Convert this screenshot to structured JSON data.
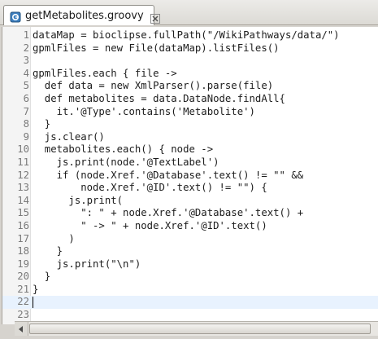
{
  "tab": {
    "title": "getMetabolites.groovy",
    "icon": "groovy-file-icon",
    "close_icon": "close-icon"
  },
  "editor": {
    "current_line": 22,
    "lines": [
      {
        "n": "1",
        "text": "dataMap = bioclipse.fullPath(\"/WikiPathways/data/\")"
      },
      {
        "n": "2",
        "text": "gpmlFiles = new File(dataMap).listFiles()"
      },
      {
        "n": "3",
        "text": ""
      },
      {
        "n": "4",
        "text": "gpmlFiles.each { file ->"
      },
      {
        "n": "5",
        "text": "  def data = new XmlParser().parse(file)"
      },
      {
        "n": "6",
        "text": "  def metabolites = data.DataNode.findAll{"
      },
      {
        "n": "7",
        "text": "    it.'@Type'.contains('Metabolite')"
      },
      {
        "n": "8",
        "text": "  }"
      },
      {
        "n": "9",
        "text": "  js.clear()"
      },
      {
        "n": "10",
        "text": "  metabolites.each() { node ->"
      },
      {
        "n": "11",
        "text": "    js.print(node.'@TextLabel')"
      },
      {
        "n": "12",
        "text": "    if (node.Xref.'@Database'.text() != \"\" &&"
      },
      {
        "n": "13",
        "text": "        node.Xref.'@ID'.text() != \"\") {"
      },
      {
        "n": "14",
        "text": "      js.print("
      },
      {
        "n": "15",
        "text": "        \": \" + node.Xref.'@Database'.text() +"
      },
      {
        "n": "16",
        "text": "        \" -> \" + node.Xref.'@ID'.text()"
      },
      {
        "n": "17",
        "text": "      )"
      },
      {
        "n": "18",
        "text": "    }"
      },
      {
        "n": "19",
        "text": "    js.print(\"\\n\")"
      },
      {
        "n": "20",
        "text": "  }"
      },
      {
        "n": "21",
        "text": "}"
      },
      {
        "n": "22",
        "text": ""
      },
      {
        "n": "23",
        "text": ""
      }
    ]
  }
}
